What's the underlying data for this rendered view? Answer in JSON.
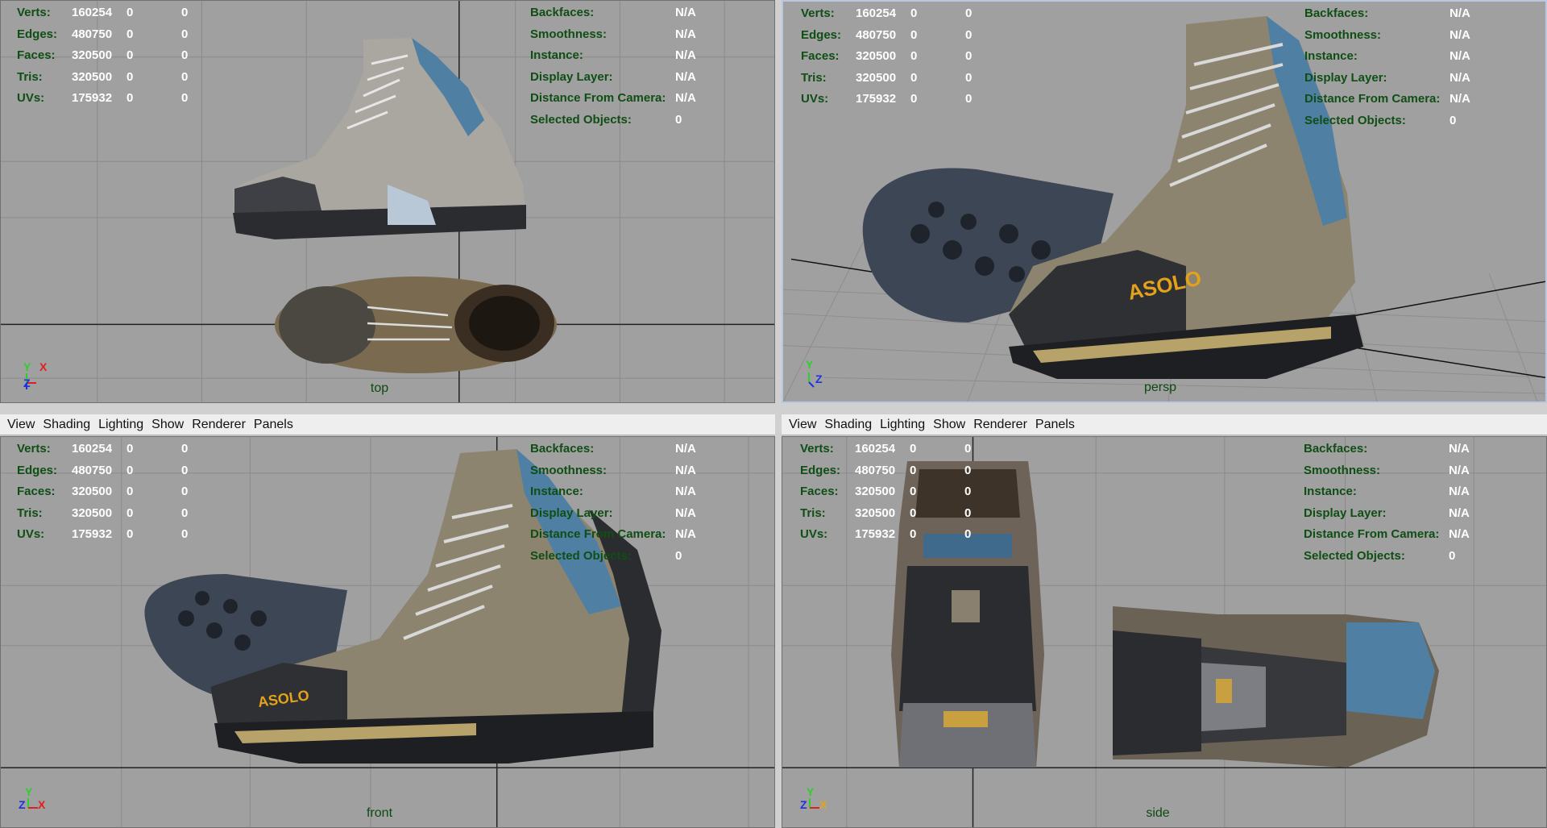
{
  "menu": [
    "View",
    "Shading",
    "Lighting",
    "Show",
    "Renderer",
    "Panels"
  ],
  "stats_left": [
    {
      "label": "Verts:",
      "v1": "160254",
      "v2": "0",
      "v3": "0"
    },
    {
      "label": "Edges:",
      "v1": "480750",
      "v2": "0",
      "v3": "0"
    },
    {
      "label": "Faces:",
      "v1": "320500",
      "v2": "0",
      "v3": "0"
    },
    {
      "label": "Tris:",
      "v1": "320500",
      "v2": "0",
      "v3": "0"
    },
    {
      "label": "UVs:",
      "v1": "175932",
      "v2": "0",
      "v3": "0"
    }
  ],
  "stats_right": [
    {
      "label": "Backfaces:",
      "value": "N/A"
    },
    {
      "label": "Smoothness:",
      "value": "N/A"
    },
    {
      "label": "Instance:",
      "value": "N/A"
    },
    {
      "label": "Display Layer:",
      "value": "N/A"
    },
    {
      "label": "Distance From Camera:",
      "value": "N/A"
    },
    {
      "label": "Selected Objects:",
      "value": "0"
    }
  ],
  "viewports": [
    {
      "camera": "top",
      "axis": [
        "Y",
        "X",
        "Z"
      ]
    },
    {
      "camera": "persp",
      "axis": [
        "Y",
        "Z"
      ]
    },
    {
      "camera": "front",
      "axis": [
        "Y",
        "Z",
        "X"
      ]
    },
    {
      "camera": "side",
      "axis": [
        "Y",
        "Z",
        "X"
      ]
    }
  ],
  "colors": {
    "viewport_bg": "#a0a0a0",
    "hud_label": "#0f4e14",
    "hud_value": "#ffffff",
    "menu_bg": "#eeeeee",
    "boot_suede": "#8d8470",
    "boot_blue": "#4f7fa3",
    "boot_sole": "#2f3033",
    "brand_orange": "#e3a21a"
  }
}
